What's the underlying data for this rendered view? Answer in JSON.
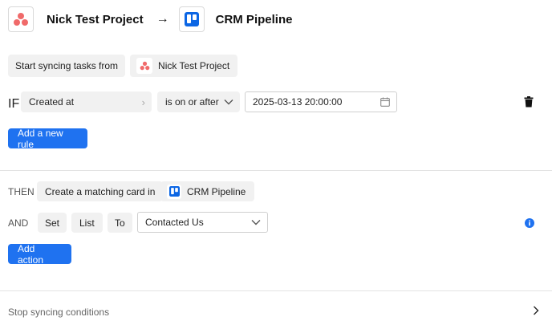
{
  "header": {
    "source_project": "Nick Test Project",
    "arrow": "→",
    "target_board": "CRM Pipeline"
  },
  "source": {
    "label": "Start syncing tasks from",
    "project": "Nick Test Project"
  },
  "rule": {
    "if_label": "IF",
    "field": "Created at",
    "field_chevron": "›",
    "operator": "is on or after",
    "value": "2025-03-13 20:00:00"
  },
  "add_rule_button": "Add a new rule",
  "then": {
    "then_label": "THEN",
    "action": "Create a matching card in",
    "board": "CRM Pipeline"
  },
  "and": {
    "and_label": "AND",
    "set": "Set",
    "list": "List",
    "to": "To",
    "value": "Contacted Us"
  },
  "add_action_button": "Add action",
  "footer": {
    "stop_label": "Stop syncing conditions",
    "chevron": "›"
  },
  "colors": {
    "primary": "#1f72f0",
    "asana": "#f06a6a",
    "trello": "#0c66e4",
    "info": "#1f72f0"
  },
  "icons": [
    "asana-logo-icon",
    "trello-logo-icon",
    "arrow-right-icon",
    "calendar-icon",
    "trash-icon",
    "chevron-down-icon",
    "info-icon",
    "chevron-right-icon"
  ]
}
